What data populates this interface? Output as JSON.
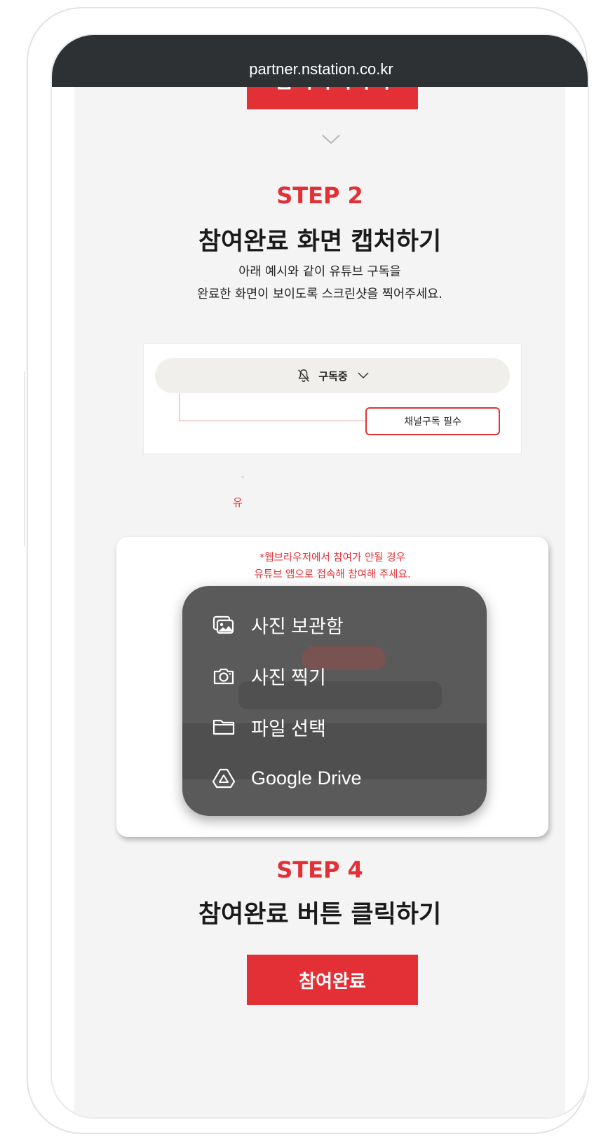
{
  "browser": {
    "url": "partner.nstation.co.kr"
  },
  "top_button": {
    "label": "참여하러가기"
  },
  "step2": {
    "label": "STEP 2",
    "title": "참여완료 화면 캡처하기",
    "desc_line1": "아래 예시와 같이 유튜브 구독을",
    "desc_line2": "완료한 화면이 보이도록 스크린샷을 찍어주세요."
  },
  "example": {
    "subscribe_label": "구독중",
    "required_label": "채널구독 필수"
  },
  "fragment_text": "유",
  "step3_card": {
    "note_line1": "*웹브라우저에서 참여가 안될 경우",
    "note_line2": "유튜브 앱으로 접속해 참여해 주세요."
  },
  "picker": {
    "items": [
      {
        "label": "사진 보관함",
        "icon": "photo-library-icon"
      },
      {
        "label": "사진 찍기",
        "icon": "camera-icon"
      },
      {
        "label": "파일 선택",
        "icon": "folder-icon"
      },
      {
        "label": "Google Drive",
        "icon": "google-drive-icon"
      }
    ]
  },
  "step4": {
    "label": "STEP 4",
    "title": "참여완료 버튼 클릭하기"
  },
  "bottom_button": {
    "label": "참여완료"
  },
  "colors": {
    "accent": "#e33036",
    "status_bar": "#2e3133",
    "page_bg": "#f4f4f4",
    "picker_bg": "#5a5a5a"
  }
}
